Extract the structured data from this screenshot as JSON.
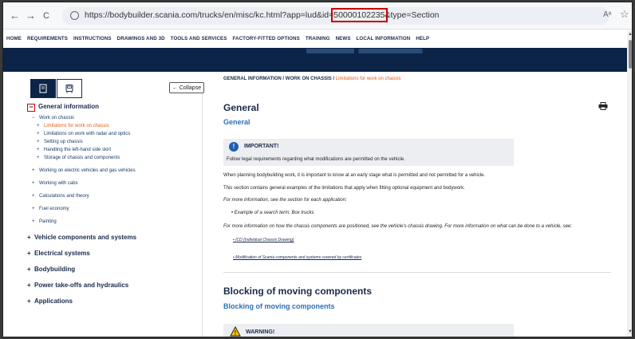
{
  "browser": {
    "back": "←",
    "forward": "→",
    "reload": "C",
    "url_prefix": "https://bodybuilder.scania.com/trucks/en/misc/kc.html?app=lud&id=",
    "url_highlight": "50000102235",
    "url_suffix": "&type=Section",
    "read_aloud": "Aᵃ",
    "favorite": "☆"
  },
  "sitenav": [
    "HOME",
    "REQUIREMENTS",
    "INSTRUCTIONS",
    "DRAWINGS AND 3D",
    "TOOLS AND SERVICES",
    "FACTORY-FITTED OPTIONS",
    "TRAINING",
    "NEWS",
    "LOCAL INFORMATION",
    "HELP"
  ],
  "sidebar": {
    "collapse_label": "← Collapse",
    "section_open": "General information",
    "work_on_chassis": "Work on chassis",
    "sub_items": [
      "Limitations for work on chassis",
      "Limitations on work with radar and optics",
      "Setting up chassis",
      "Handling the left-hand side skirt",
      "Storage of chassis and components"
    ],
    "level1": [
      "Working on electric vehicles and gas vehicles",
      "Working with cabs",
      "Calculations and theory",
      "Fuel economy",
      "Painting"
    ],
    "sections": [
      "Vehicle components and systems",
      "Electrical systems",
      "Bodybuilding",
      "Power take-offs and hydraulics",
      "Applications"
    ]
  },
  "main": {
    "breadcrumb": {
      "a": "GENERAL INFORMATION",
      "sep": " / ",
      "b": "WORK ON CHASSIS",
      "c": "Limitations for work on chassis"
    },
    "h1": "General",
    "h2": "General",
    "important_title": "IMPORTANT!",
    "important_body": "Follow legal requirements regarding what modifications are permitted on the vehicle.",
    "p1": "When planning bodybuilding work, it is important to know at an early stage what is permitted and not permitted for a vehicle.",
    "p2": "This section contains general examples of the limitations that apply when fitting optional equipment and bodywork.",
    "p3": "For more information, see the section for each application:",
    "bullet1": "•  Example of a search term: Box trucks",
    "p4": "For more information on how the chassis components are positioned, see the vehicle's chassis drawing. For more information on what can be done to a vehicle, see:",
    "link1": "•  ICD (Individual Chassis Drawing)",
    "link2": "•  Modification of Scania components and systems covered by certificates",
    "h1b": "Blocking of moving components",
    "h2b": "Blocking of moving components",
    "warning_title": "WARNING!"
  },
  "colors": {
    "navy": "#0b2447",
    "accent": "#e8591a",
    "link_blue": "#2d6fb5",
    "highlight": "#cc0000"
  }
}
